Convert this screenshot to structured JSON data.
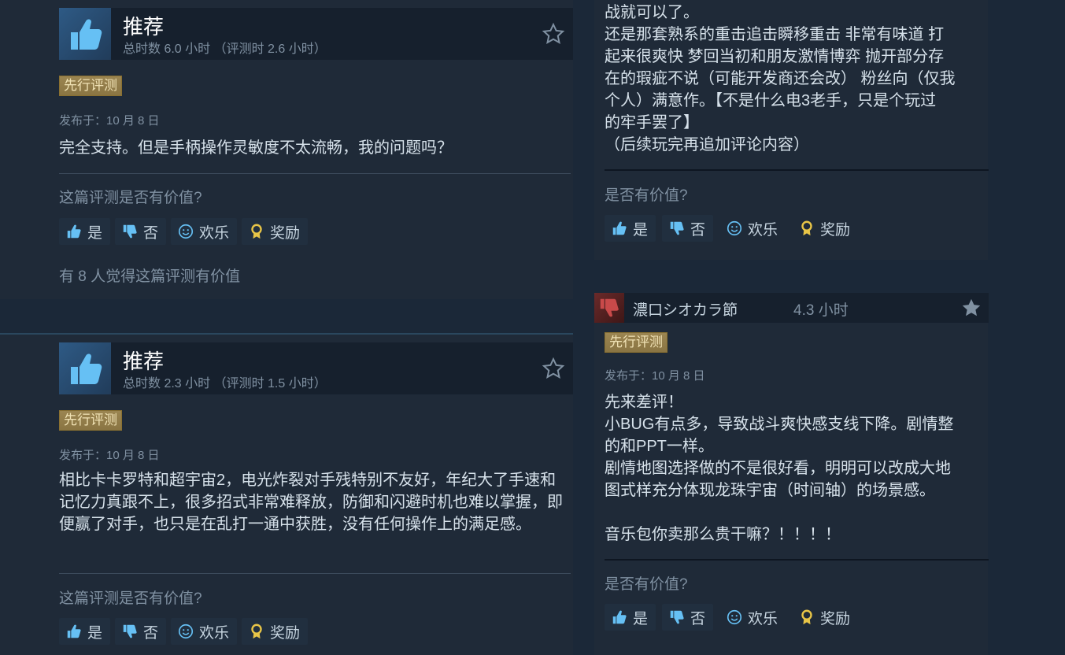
{
  "reviews_left": [
    {
      "verdict": "推荐",
      "hours": "总时数 6.0 小时 （评测时 2.6 小时）",
      "badge": "先行评测",
      "posted": "发布于：10 月 8 日",
      "content": "完全支持。但是手柄操作灵敏度不太流畅，我的问题吗？",
      "helpful_question": "这篇评测是否有价值?",
      "buttons": {
        "yes": "是",
        "no": "否",
        "funny": "欢乐",
        "award": "奖励"
      },
      "helpful_count": "有 8 人觉得这篇评测有价值"
    },
    {
      "verdict": "推荐",
      "hours": "总时数 2.3 小时 （评测时 1.5 小时）",
      "badge": "先行评测",
      "posted": "发布于：10 月 8 日",
      "content": "相比卡卡罗特和超宇宙2，电光炸裂对手残特别不友好，年纪大了手速和记忆力真跟不上，很多招式非常难释放，防御和闪避时机也难以掌握，即便赢了对手，也只是在乱打一通中获胜，没有任何操作上的满足感。",
      "helpful_question": "这篇评测是否有价值?",
      "buttons": {
        "yes": "是",
        "no": "否",
        "funny": "欢乐",
        "award": "奖励"
      }
    }
  ],
  "reviews_right": [
    {
      "content_lines": [
        "战就可以了。",
        "还是那套熟系的重击追击瞬移重击 非常有味道 打",
        "起来很爽快 梦回当初和朋友激情博弈 抛开部分存",
        "在的瑕疵不说（可能开发商还会改） 粉丝向（仅我",
        "个人）满意作。【不是什么电3老手，只是个玩过",
        "的牢手罢了】",
        "（后续玩完再追加评论内容）"
      ],
      "helpful_question": "是否有价值?",
      "buttons": {
        "yes": "是",
        "no": "否",
        "funny": "欢乐",
        "award": "奖励"
      }
    },
    {
      "username": "濃口シオカラ節",
      "hours": "4.3 小时",
      "badge": "先行评测",
      "posted": "发布于：10 月 8 日",
      "content_lines": [
        "先来差评！",
        "小BUG有点多，导致战斗爽快感支线下降。剧情整",
        "的和PPT一样。",
        "剧情地图选择做的不是很好看，明明可以改成大地",
        "图式样充分体现龙珠宇宙（时间轴）的场景感。",
        "",
        "音乐包你卖那么贵干嘛？！！！！"
      ],
      "helpful_question": "是否有价值?",
      "buttons": {
        "yes": "是",
        "no": "否",
        "funny": "欢乐",
        "award": "奖励"
      }
    }
  ]
}
